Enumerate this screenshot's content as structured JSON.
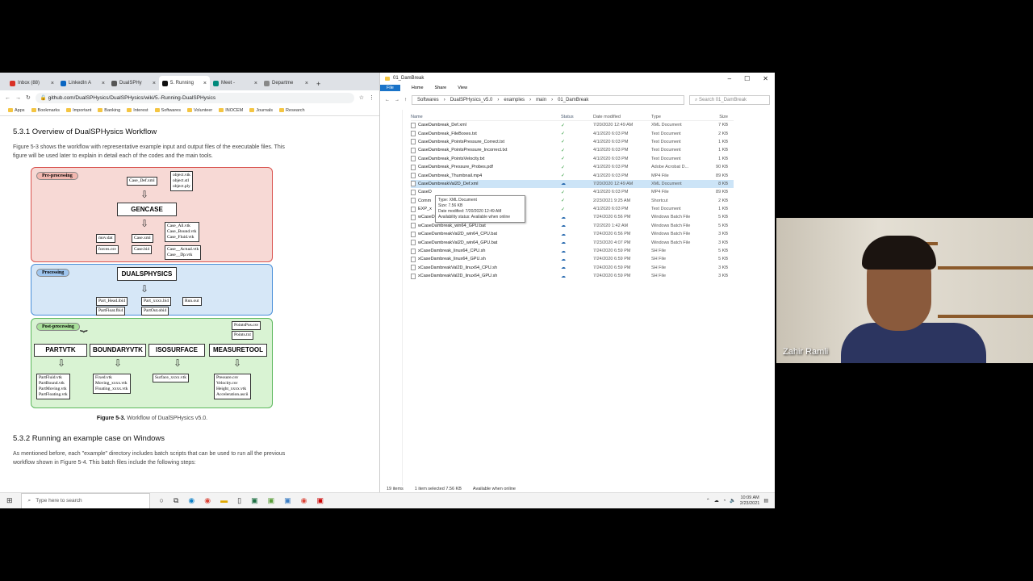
{
  "browser": {
    "tabs": [
      {
        "label": "Inbox (88)",
        "color": "#d93025"
      },
      {
        "label": "LinkedIn A",
        "color": "#0a66c2"
      },
      {
        "label": "DualSPHy",
        "color": "#555555"
      },
      {
        "label": "5. Running",
        "color": "#111111",
        "active": true
      },
      {
        "label": "Meet -",
        "color": "#00897b"
      },
      {
        "label": "Departme",
        "color": "#888888"
      }
    ],
    "url": "github.com/DualSPHysics/DualSPHysics/wiki/5.-Running-DualSPHysics",
    "bookmarks": [
      "Apps",
      "Bookmarks",
      "Important",
      "Banking",
      "Interest",
      "Softwares",
      "Volunteer",
      "INOCEM",
      "Journals",
      "Research"
    ],
    "page": {
      "heading1": "5.3.1 Overview of DualSPHysics Workflow",
      "para1": "Figure 5-3 shows the workflow with representative example input and output files of the executable files. This figure will be used later to explain in detail each of the codes and the main tools.",
      "caption_bold": "Figure 5-3.",
      "caption_text": " Workflow of DualSPHysics v5.0.",
      "heading2": "5.3.2 Running an example case on Windows",
      "para2": "As mentioned before, each \"example\" directory includes batch scripts that can be used to run all the previous workflow shown in Figure 5-4. This batch files include the following steps:"
    },
    "diagram": {
      "pre": "Pre-processing",
      "proc": "Processing",
      "post": "Post-processing",
      "gencase": "GENCASE",
      "dualsphysics": "DUALSPHYSICS",
      "case_def": "Case_Def.xml",
      "objects": "object.vtk\nobject.stl\nobject.ply",
      "mov": "mov.dat",
      "forces": "forces.csv",
      "case_xml": "Case.xml",
      "case_bi4": "Case.bi4",
      "case_vtks": "Case_All.vtk\nCase_Bound.vtk\nCase_Fluid.vtk",
      "case_actual": "Case__Actual.vtk\nCase__Dp.vtk",
      "part_head": "Part_Head.ibi4",
      "part_xxxx": "Part_xxxx.bi4",
      "run_out": "Run.out",
      "partfloat": "PartFloat.fbi4",
      "partout": "PartOut.obi4",
      "pointspos": "PointsPos.csv",
      "points": "Points.txt",
      "partvtk": "PARTVTK",
      "boundaryvtk": "BOUNDARYVTK",
      "isosurface": "ISOSURFACE",
      "measuretool": "MEASURETOOL",
      "out_partvtk": "PartFluid.vtk\nPartBound.vtk\nPartMoving.vtk\nPartFloating.vtk",
      "out_boundary": "Fixed.vtk\nMoving_xxxx.vtk\nFloating_xxxx.vtk",
      "out_iso": "Surface_xxxx.vtk",
      "out_measure": "Pressure.csv\nVelocity.csv\nHeight_xxxx.vtk\nAcceleration.ascii"
    }
  },
  "explorer": {
    "title": "01_DamBreak",
    "ribbon": [
      "File",
      "Home",
      "Share",
      "View"
    ],
    "path": [
      "Softwares",
      "DualSPHysics_v5.0",
      "examples",
      "main",
      "01_DamBreak"
    ],
    "search_placeholder": "Search 01_DamBreak",
    "columns": [
      "Name",
      "Status",
      "Date modified",
      "Type",
      "Size"
    ],
    "files": [
      {
        "name": "CaseDambreak_Def.xml",
        "status": "ok",
        "date": "7/20/2020 12:49 AM",
        "type": "XML Document",
        "size": "7 KB"
      },
      {
        "name": "CaseDambreak_FileBoxes.txt",
        "status": "ok",
        "date": "4/1/2020 6:03 PM",
        "type": "Text Document",
        "size": "2 KB"
      },
      {
        "name": "CaseDambreak_PointsPressure_Correct.txt",
        "status": "ok",
        "date": "4/1/2020 6:03 PM",
        "type": "Text Document",
        "size": "1 KB"
      },
      {
        "name": "CaseDambreak_PointsPressure_Incorrect.txt",
        "status": "ok",
        "date": "4/1/2020 6:03 PM",
        "type": "Text Document",
        "size": "1 KB"
      },
      {
        "name": "CaseDambreak_PointsVelocity.txt",
        "status": "ok",
        "date": "4/1/2020 6:03 PM",
        "type": "Text Document",
        "size": "1 KB"
      },
      {
        "name": "CaseDambreak_Pressure_Probes.pdf",
        "status": "ok",
        "date": "4/1/2020 6:03 PM",
        "type": "Adobe Acrobat D...",
        "size": "90 KB"
      },
      {
        "name": "CaseDambreak_Thumbnail.mp4",
        "status": "ok",
        "date": "4/1/2020 6:03 PM",
        "type": "MP4 File",
        "size": "89 KB"
      },
      {
        "name": "CaseDambreakVal2D_Def.xml",
        "status": "cloud",
        "date": "7/20/2020 12:49 AM",
        "type": "XML Document",
        "size": "8 KB",
        "selected": true
      },
      {
        "name": "CaseD",
        "status": "ok",
        "date": "4/1/2020 6:03 PM",
        "type": "MP4 File",
        "size": "89 KB"
      },
      {
        "name": "Comm",
        "status": "ok",
        "date": "2/23/2021 9:25 AM",
        "type": "Shortcut",
        "size": "2 KB"
      },
      {
        "name": "EXP_x",
        "status": "ok",
        "date": "4/1/2020 6:03 PM",
        "type": "Text Document",
        "size": "1 KB"
      },
      {
        "name": "wCaseD",
        "status": "cloud",
        "date": "7/24/2020 6:56 PM",
        "type": "Windows Batch File",
        "size": "5 KB"
      },
      {
        "name": "wCaseDambreak_win64_GPU.bat",
        "status": "cloud",
        "date": "7/2/2020 1:42 AM",
        "type": "Windows Batch File",
        "size": "5 KB"
      },
      {
        "name": "wCaseDambreakVal2D_win64_CPU.bat",
        "status": "cloud",
        "date": "7/24/2020 6:56 PM",
        "type": "Windows Batch File",
        "size": "3 KB"
      },
      {
        "name": "wCaseDambreakVal2D_win64_GPU.bat",
        "status": "cloud",
        "date": "7/23/2020 4:07 PM",
        "type": "Windows Batch File",
        "size": "3 KB"
      },
      {
        "name": "xCaseDambreak_linux64_CPU.sh",
        "status": "cloud",
        "date": "7/24/2020 6:59 PM",
        "type": "SH File",
        "size": "5 KB"
      },
      {
        "name": "xCaseDambreak_linux64_GPU.sh",
        "status": "cloud",
        "date": "7/24/2020 6:59 PM",
        "type": "SH File",
        "size": "5 KB"
      },
      {
        "name": "xCaseDambreakVal2D_linux64_CPU.sh",
        "status": "cloud",
        "date": "7/24/2020 6:59 PM",
        "type": "SH File",
        "size": "3 KB"
      },
      {
        "name": "xCaseDambreakVal2D_linux64_GPU.sh",
        "status": "cloud",
        "date": "7/24/2020 6:59 PM",
        "type": "SH File",
        "size": "3 KB"
      }
    ],
    "tooltip": [
      "Type: XML Document",
      "Size: 7.56 KB",
      "Date modified: 7/20/2020 12:49 AM",
      "Availability status: Available when online"
    ],
    "status_items": "19 items",
    "status_selected": "1 item selected  7.56 KB",
    "status_avail": "Available when online"
  },
  "taskbar": {
    "search_placeholder": "Type here to search",
    "time": "10:09 AM",
    "date": "2/23/2021"
  },
  "webcam": {
    "name": "Zahir Ramli"
  }
}
